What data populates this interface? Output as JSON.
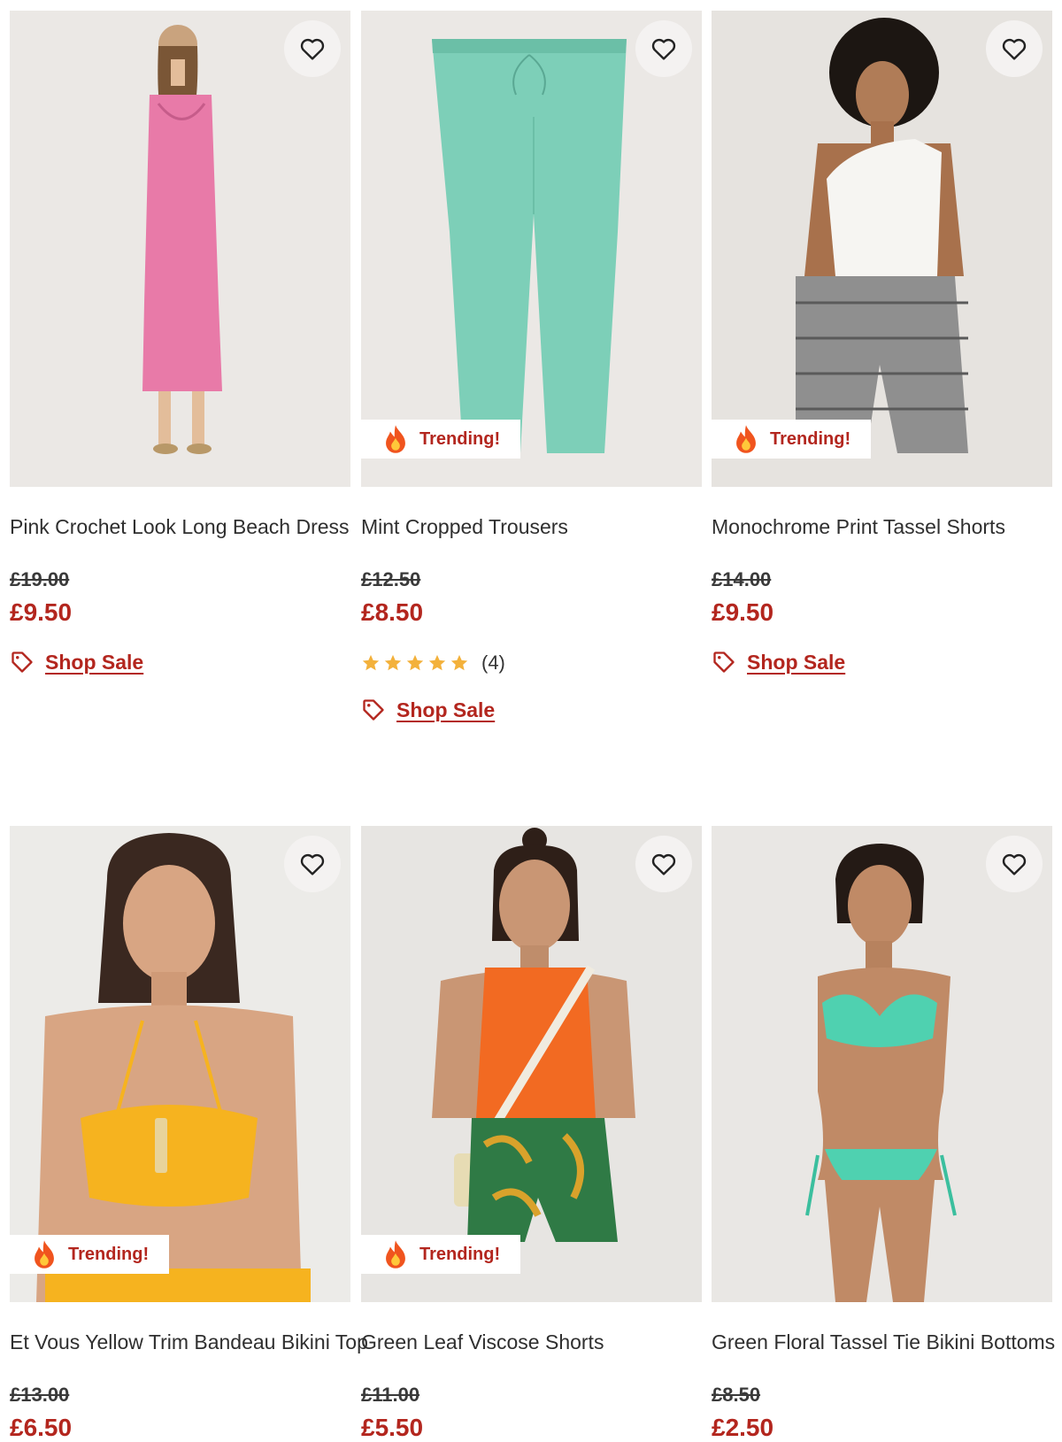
{
  "trending_label": "Trending!",
  "shop_sale_label": "Shop Sale",
  "colors": {
    "accent": "#b3261e",
    "star": "#f3b13b",
    "image_bg": "#ebe8e5"
  },
  "icons": {
    "wishlist": "heart-icon",
    "trending": "flame-icon",
    "sale": "tag-icon",
    "rating": "star-icon"
  },
  "products": [
    {
      "title": "Pink Crochet Look Long Beach Dress",
      "was_price": "£19.00",
      "now_price": "£9.50",
      "trending": false,
      "rating": null,
      "review_count": null,
      "shop_sale": true,
      "product_color": "#e87aa8"
    },
    {
      "title": "Mint Cropped Trousers",
      "was_price": "£12.50",
      "now_price": "£8.50",
      "trending": true,
      "rating": 5,
      "review_count": "(4)",
      "shop_sale": true,
      "product_color": "#7dcfb8"
    },
    {
      "title": "Monochrome Print Tassel Shorts",
      "was_price": "£14.00",
      "now_price": "£9.50",
      "trending": true,
      "rating": null,
      "review_count": null,
      "shop_sale": true,
      "product_color": "#8f8f8f"
    },
    {
      "title": "Et Vous Yellow Trim Bandeau Bikini Top",
      "was_price": "£13.00",
      "now_price": "£6.50",
      "trending": true,
      "rating": null,
      "review_count": null,
      "shop_sale": false,
      "product_color": "#f6b31f"
    },
    {
      "title": "Green Leaf Viscose Shorts",
      "was_price": "£11.00",
      "now_price": "£5.50",
      "trending": true,
      "rating": null,
      "review_count": null,
      "shop_sale": false,
      "product_color": "#f26a22"
    },
    {
      "title": "Green Floral Tassel Tie Bikini Bottoms",
      "was_price": "£8.50",
      "now_price": "£2.50",
      "trending": false,
      "rating": null,
      "review_count": null,
      "shop_sale": false,
      "product_color": "#4fd1b0"
    }
  ]
}
